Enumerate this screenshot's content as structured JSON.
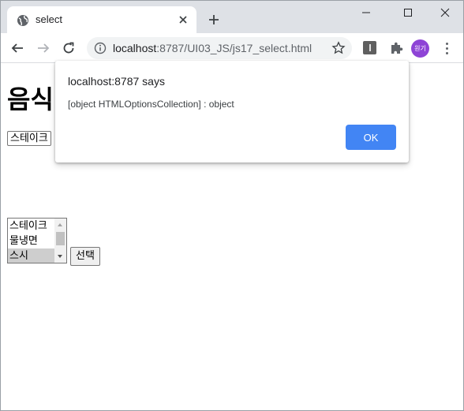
{
  "tab": {
    "title": "select",
    "favicon": "globe-icon"
  },
  "toolbar": {
    "url_host": "localhost",
    "url_rest": ":8787/UI03_JS/js17_select.html",
    "profile_label": "원기",
    "extension_label": "I"
  },
  "page": {
    "title": "음식",
    "dropdown_value": "스테이크",
    "listbox_options": [
      "스테이크",
      "물냉면",
      "스시"
    ],
    "listbox_selected": "스시",
    "choose_button": "선택"
  },
  "dialog": {
    "title": "localhost:8787 says",
    "message": "[object HTMLOptionsCollection] : object",
    "ok_label": "OK"
  },
  "colors": {
    "accent": "#4285f4",
    "tabstrip": "#dee1e6",
    "profile": "#8e44d6"
  }
}
